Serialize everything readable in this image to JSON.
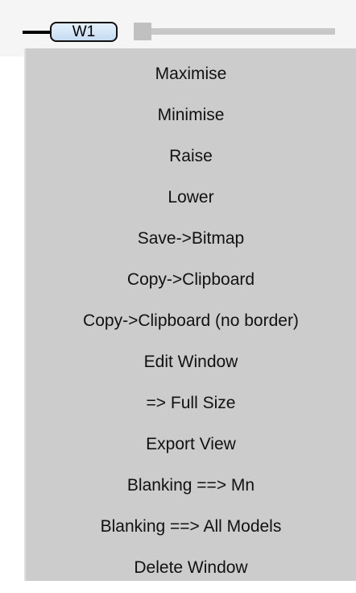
{
  "window_tab": {
    "label": "W1"
  },
  "menu": {
    "items": [
      {
        "label": "Maximise"
      },
      {
        "label": "Minimise"
      },
      {
        "label": "Raise"
      },
      {
        "label": "Lower"
      },
      {
        "label": "Save->Bitmap"
      },
      {
        "label": "Copy->Clipboard"
      },
      {
        "label": "Copy->Clipboard (no border)"
      },
      {
        "label": "Edit Window"
      },
      {
        "label": "=> Full Size"
      },
      {
        "label": "Export View"
      },
      {
        "label": "Blanking ==> Mn"
      },
      {
        "label": "Blanking ==> All Models"
      },
      {
        "label": "Delete Window"
      }
    ]
  }
}
